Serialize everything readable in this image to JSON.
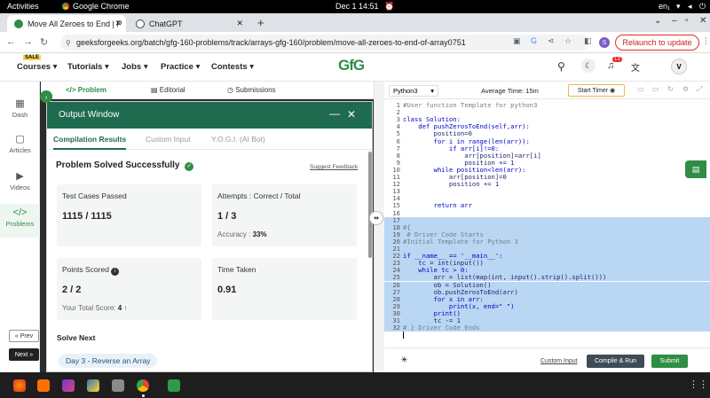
{
  "system": {
    "activities": "Activities",
    "app": "Google Chrome",
    "clock": "Dec 1  14:51",
    "lang": "en₁"
  },
  "browser": {
    "tabs": [
      {
        "title": "Move All Zeroes to End | P"
      },
      {
        "title": "ChatGPT"
      }
    ],
    "new_tab": "+",
    "url": "geeksforgeeks.org/batch/gfg-160-problems/track/arrays-gfg-160/problem/move-all-zeroes-to-end-of-array0751",
    "relaunch": "Relaunch to update",
    "profile_initial": "S"
  },
  "site": {
    "sale": "SALE",
    "menu": [
      "Courses",
      "Tutorials",
      "Jobs",
      "Practice",
      "Contests"
    ],
    "logo": "GfG",
    "notif_count": "13",
    "avatar": "V"
  },
  "rail": {
    "items": [
      "Dash",
      "Articles",
      "Videos",
      "Problems"
    ],
    "prev": "« Prev",
    "next": "Next »"
  },
  "problem_tabs": [
    "Problem",
    "Editorial",
    "Submissions"
  ],
  "output": {
    "title": "Output Window",
    "tabs": [
      "Compilation Results",
      "Custom Input",
      "Y.O.G.I. (AI Bot)"
    ],
    "status": "Problem Solved Successfully",
    "feedback": "Suggest Feedback",
    "cards": [
      {
        "label": "Test Cases Passed",
        "value": "1115 / 1115",
        "sub": ""
      },
      {
        "label": "Attempts : Correct / Total",
        "value": "1 / 3",
        "sub": "Accuracy : ",
        "sub_value": "33%"
      },
      {
        "label": "Points Scored",
        "value": "2 / 2",
        "sub": "Your Total Score: ",
        "sub_value": "4"
      },
      {
        "label": "Time Taken",
        "value": "0.91",
        "sub": ""
      }
    ],
    "solve_next": "Solve Next",
    "next_item": "Day 3 - Reverse an Array"
  },
  "editor": {
    "language": "Python3",
    "avg_time": "Average Time: 15m",
    "start_timer": "Start Timer",
    "custom_input": "Custom Input",
    "compile": "Compile & Run",
    "submit": "Submit",
    "lines": [
      "#User function Template for python3",
      "",
      "class Solution:",
      "    def pushZerosToEnd(self,arr):",
      "        position=0",
      "        for i in range(len(arr)):",
      "            if arr[i]!=0:",
      "                arr[position]=arr[i]",
      "                position += 1",
      "        while position<len(arr):",
      "            arr[position]=0",
      "            position += 1",
      "",
      "",
      "        return arr",
      "",
      "",
      "#{",
      " # Driver Code Starts",
      "#Initial Template for Python 3",
      "",
      "if __name__ == '__main__':",
      "    tc = int(input())",
      "    while tc > 0:",
      "        arr = list(map(int, input().strip().split()))",
      "        ob = Solution()",
      "        ob.pushZerosToEnd(arr)",
      "        for x in arr:",
      "            print(x, end=\" \")",
      "        print()",
      "        tc -= 1",
      "# } Driver Code Ends"
    ]
  },
  "colors": {
    "gfg_green": "#2f8d46",
    "header_green": "#1f6b4f",
    "selection": "#b9d6f3"
  }
}
